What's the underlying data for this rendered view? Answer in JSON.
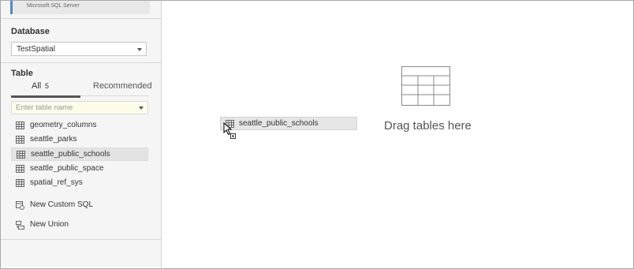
{
  "connection": {
    "server_type": "Microsoft SQL Server"
  },
  "database": {
    "label": "Database",
    "selected": "TestSpatial"
  },
  "table_section": {
    "label": "Table",
    "tabs": {
      "all_label": "All",
      "all_count": "5",
      "recommended_label": "Recommended"
    },
    "search_placeholder": "Enter table name",
    "tables": [
      {
        "name": "geometry_columns",
        "icon": "table-grid-icon"
      },
      {
        "name": "seattle_parks",
        "icon": "table-grid-icon"
      },
      {
        "name": "seattle_public_schools",
        "icon": "table-grid-icon",
        "selected": true
      },
      {
        "name": "seattle_public_space",
        "icon": "table-grid-icon"
      },
      {
        "name": "spatial_ref_sys",
        "icon": "table-grid-icon"
      }
    ],
    "actions": [
      {
        "name": "New Custom SQL",
        "icon": "custom-sql-icon"
      },
      {
        "name": "New Union",
        "icon": "union-icon"
      }
    ]
  },
  "canvas": {
    "dragging_table": "seattle_public_schools",
    "drop_hint": "Drag tables here"
  },
  "colors": {
    "accent": "#4f8ac9",
    "sidebar_bg": "#f5f5f5",
    "search_bg": "#fffce9",
    "selected_bg": "#e3e3e3"
  }
}
